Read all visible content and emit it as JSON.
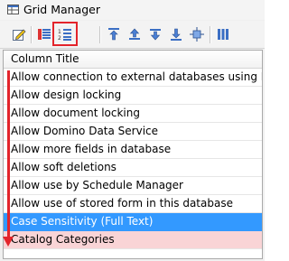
{
  "window": {
    "title": "Grid Manager",
    "app_icon": "grid-manager-icon"
  },
  "toolbar": {
    "buttons": [
      {
        "name": "edit-icon"
      },
      {
        "name": "column-list-icon"
      },
      {
        "name": "numbered-list-icon",
        "highlighted": true
      },
      {
        "name": "move-top-icon"
      },
      {
        "name": "move-up-icon"
      },
      {
        "name": "move-down-icon"
      },
      {
        "name": "move-bottom-icon"
      },
      {
        "name": "move-center-icon"
      },
      {
        "name": "columns-icon"
      }
    ]
  },
  "grid": {
    "column_title": "Column Title",
    "rows": [
      {
        "label": "Allow connection to external databases using DCRs",
        "state": "normal"
      },
      {
        "label": "Allow design locking",
        "state": "normal"
      },
      {
        "label": "Allow document locking",
        "state": "normal"
      },
      {
        "label": "Allow Domino Data Service",
        "state": "normal"
      },
      {
        "label": "Allow more fields in database",
        "state": "normal"
      },
      {
        "label": "Allow soft deletions",
        "state": "normal"
      },
      {
        "label": "Allow use by Schedule Manager",
        "state": "normal"
      },
      {
        "label": "Allow use of stored form in this database",
        "state": "normal"
      },
      {
        "label": "Case Sensitivity (Full Text)",
        "state": "selected"
      },
      {
        "label": "Catalog Categories",
        "state": "highlighted"
      }
    ]
  },
  "colors": {
    "selection": "#3399ff",
    "annotation_red": "#e3242b",
    "pink_row": "#f9d4d6"
  }
}
